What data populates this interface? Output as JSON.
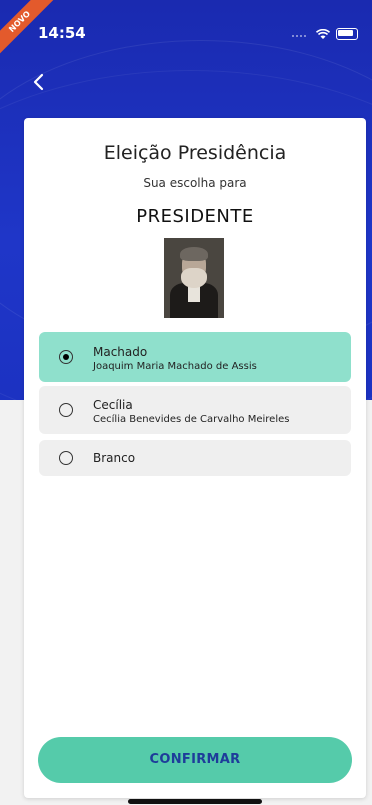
{
  "status_bar": {
    "time": "14:54",
    "ribbon": "NOVO"
  },
  "header": {
    "back_icon": "chevron-left-icon"
  },
  "card": {
    "title": "Eleição Presidência",
    "subtitle": "Sua escolha para",
    "role": "PRESIDENTE"
  },
  "options": [
    {
      "name": "Machado",
      "full_name": "Joaquim Maria Machado de Assis",
      "selected": true
    },
    {
      "name": "Cecília",
      "full_name": "Cecília Benevides de Carvalho Meireles",
      "selected": false
    },
    {
      "name": "Branco",
      "full_name": "",
      "selected": false
    }
  ],
  "actions": {
    "confirm_label": "CONFIRMAR"
  },
  "colors": {
    "header_blue": "#1d2fb8",
    "selected_option": "#8fe0cc",
    "confirm_button": "#55cbaa",
    "confirm_text": "#1e3c9a"
  }
}
